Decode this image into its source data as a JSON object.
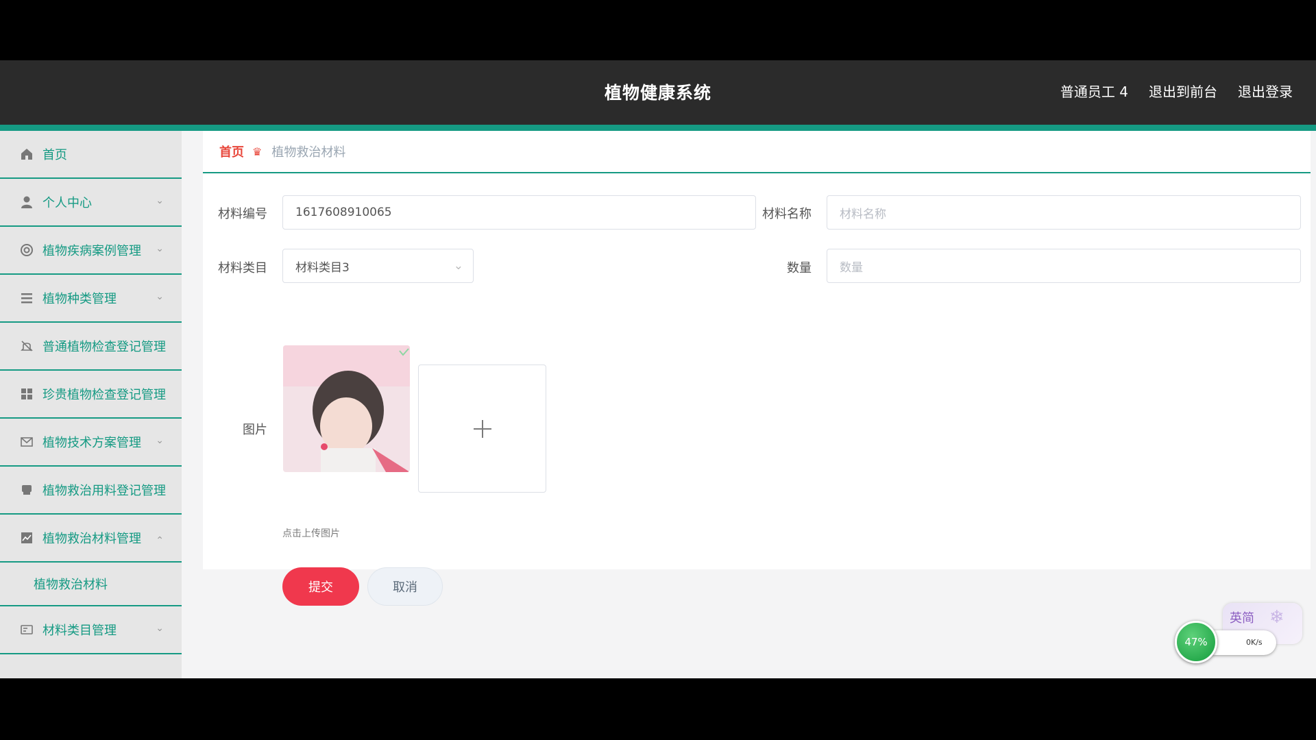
{
  "header": {
    "title": "植物健康系统",
    "user": "普通员工 4",
    "to_front": "退出到前台",
    "logout": "退出登录"
  },
  "sidebar": {
    "items": [
      {
        "label": "首页",
        "icon": "home-icon"
      },
      {
        "label": "个人中心",
        "icon": "user-icon"
      },
      {
        "label": "植物疾病案例管理",
        "icon": "lifebuoy-icon"
      },
      {
        "label": "植物种类管理",
        "icon": "list-icon"
      },
      {
        "label": "普通植物检查登记管理",
        "icon": "bell-off-icon"
      },
      {
        "label": "珍贵植物检查登记管理",
        "icon": "grid-icon"
      },
      {
        "label": "植物技术方案管理",
        "icon": "mail-icon"
      },
      {
        "label": "植物救治用料登记管理",
        "icon": "printer-icon"
      },
      {
        "label": "植物救治材料管理",
        "icon": "chart-icon"
      },
      {
        "label": "材料类目管理",
        "icon": "id-card-icon"
      }
    ],
    "sub_item": "植物救治材料"
  },
  "breadcrumb": {
    "home": "首页",
    "current": "植物救治材料"
  },
  "form": {
    "code_label": "材料编号",
    "code_value": "1617608910065",
    "name_label": "材料名称",
    "name_placeholder": "材料名称",
    "category_label": "材料类目",
    "category_value": "材料类目3",
    "qty_label": "数量",
    "qty_placeholder": "数量",
    "image_label": "图片",
    "upload_tip": "点击上传图片",
    "submit": "提交",
    "cancel": "取消"
  },
  "widget": {
    "percent": "47%",
    "ime": "英简",
    "speed": "0K/s"
  },
  "colors": {
    "accent": "#159a83",
    "header_bg": "#2b2b2b",
    "submit": "#f0384d",
    "breadcrumb_home": "#e8473b"
  }
}
